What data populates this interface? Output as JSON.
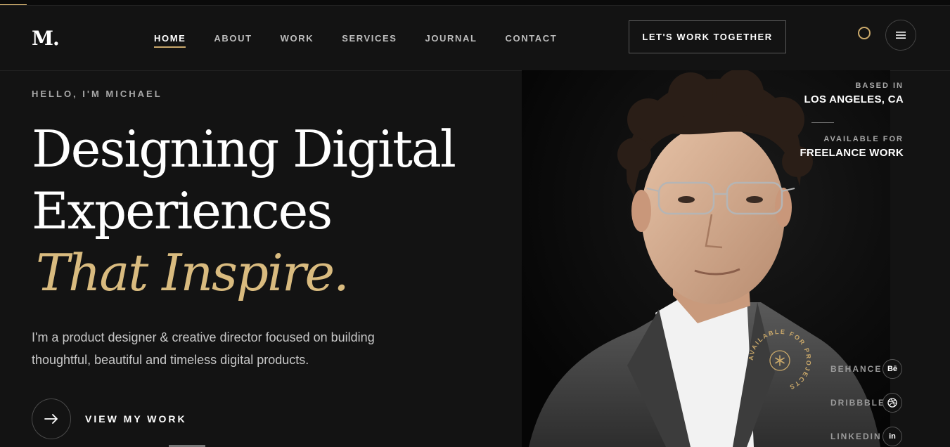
{
  "logo": "M.",
  "nav": {
    "items": [
      {
        "label": "HOME",
        "active": true
      },
      {
        "label": "ABOUT",
        "active": false
      },
      {
        "label": "WORK",
        "active": false
      },
      {
        "label": "SERVICES",
        "active": false
      },
      {
        "label": "JOURNAL",
        "active": false
      },
      {
        "label": "CONTACT",
        "active": false
      }
    ]
  },
  "cta_label": "LET'S WORK TOGETHER",
  "icons": {
    "theme": "circle-icon",
    "menu": "hamburger-menu-icon",
    "arrow": "arrow-right-icon"
  },
  "hero": {
    "greeting": "HELLO, I'M MICHAEL",
    "headline_line1": "Designing Digital",
    "headline_line2": "Experiences",
    "headline_line3": "That Inspire.",
    "description": "I'm a product designer & creative director focused on building thoughtful, beautiful and timeless digital products.",
    "view_work_label": "VIEW MY WORK"
  },
  "meta": {
    "based_label": "BASED IN",
    "based_value": "LOS ANGELES, CA",
    "available_label": "AVAILABLE FOR",
    "available_value": "FREELANCE WORK"
  },
  "badge_text": "AVAILABLE FOR PROJECTS",
  "social": [
    {
      "name": "BEHANCE",
      "glyph": "Bē",
      "icon": "behance-icon"
    },
    {
      "name": "DRIBBBLE",
      "glyph": "",
      "icon": "dribbble-icon"
    },
    {
      "name": "LINKEDIN",
      "glyph": "in",
      "icon": "linkedin-icon"
    }
  ],
  "colors": {
    "accent": "#c9a86a",
    "accent_text": "#d9bb7f",
    "background": "#131313"
  }
}
